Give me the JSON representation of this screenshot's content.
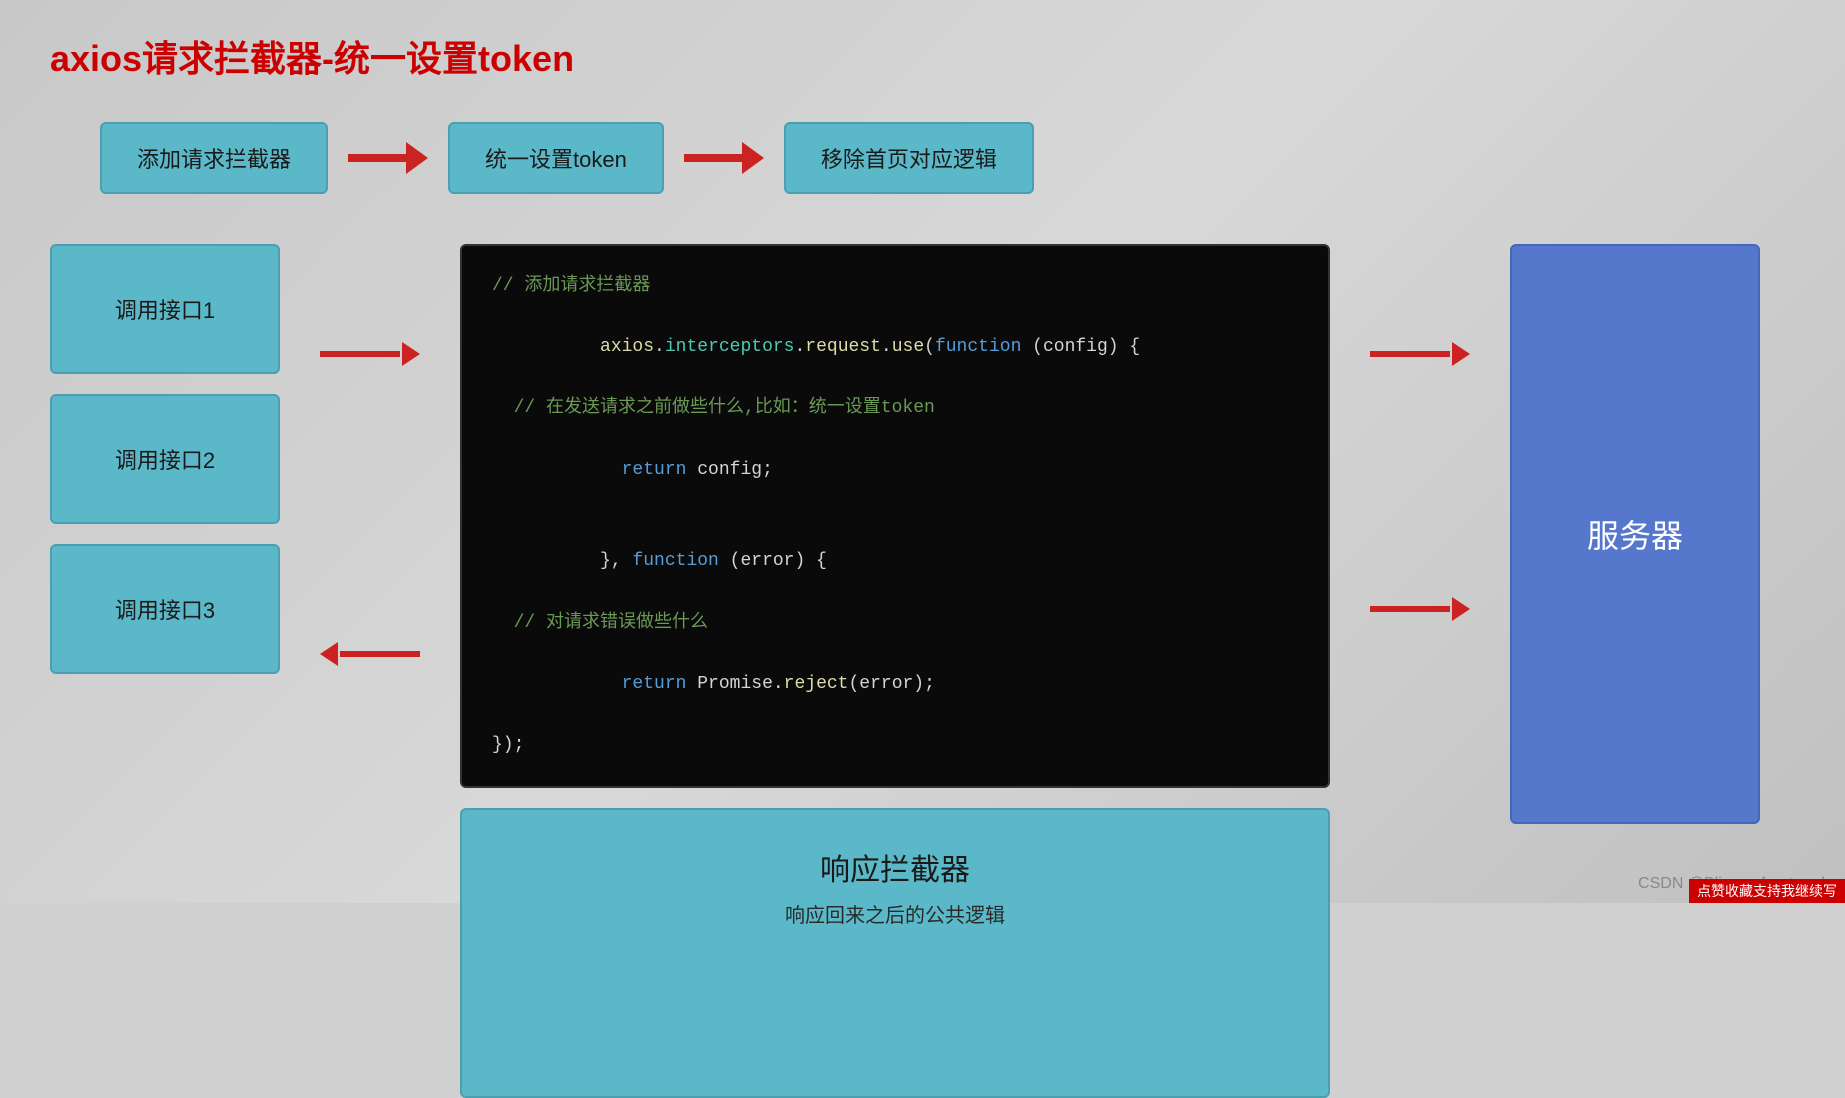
{
  "title": "axios请求拦截器-统一设置token",
  "topFlow": {
    "box1": "添加请求拦截器",
    "box2": "统一设置token",
    "box3": "移除首页对应逻辑"
  },
  "apiBoxes": {
    "api1": "调用接口1",
    "api2": "调用接口2",
    "api3": "调用接口3"
  },
  "codeBlock": {
    "line1": "// 添加请求拦截器",
    "line2": "axios.interceptors.request.use(",
    "line2_fn": "function",
    "line2_rest": " (config) {",
    "line3": "  // 在发送请求之前做些什么,比如：统一设置token",
    "line4": "  return config;",
    "line5": "},",
    "line5_fn": " function",
    "line5_rest": " (error) {",
    "line6": "  // 对请求错误做些什么",
    "line7": "  return Promise.reject(error);",
    "line8": "});"
  },
  "responseBox": {
    "title": "响应拦截器",
    "subtitle": "响应回来之后的公共逻辑"
  },
  "serverBox": {
    "label": "服务器"
  },
  "watermark": "CSDN @Blizzar_front-end",
  "watermarkRed": "点赞收藏支持我继续写"
}
